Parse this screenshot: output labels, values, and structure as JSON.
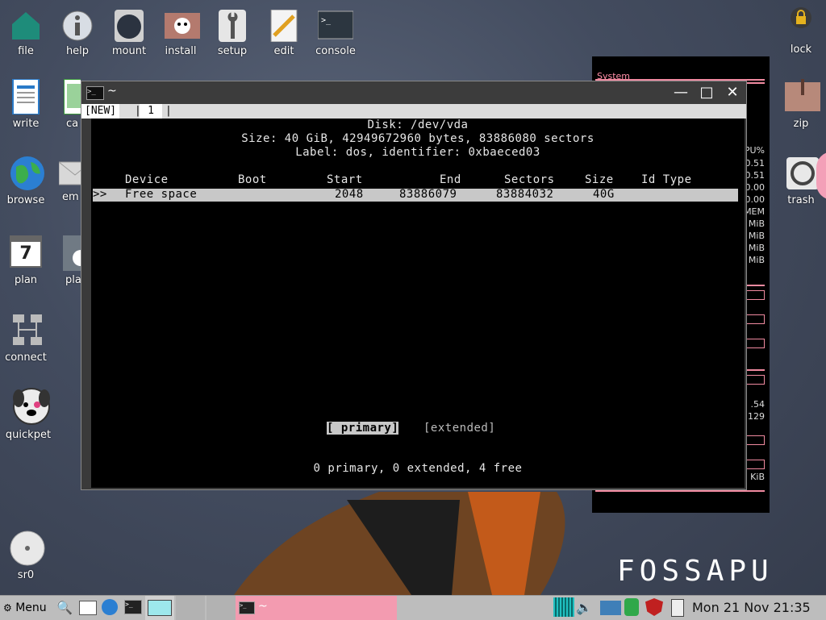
{
  "desktop": {
    "icons": [
      {
        "id": "file",
        "label": "file"
      },
      {
        "id": "help",
        "label": "help"
      },
      {
        "id": "mount",
        "label": "mount"
      },
      {
        "id": "install",
        "label": "install"
      },
      {
        "id": "setup",
        "label": "setup"
      },
      {
        "id": "edit",
        "label": "edit"
      },
      {
        "id": "console",
        "label": "console"
      },
      {
        "id": "lock",
        "label": "lock"
      },
      {
        "id": "write",
        "label": "write"
      },
      {
        "id": "calc",
        "label": "ca"
      },
      {
        "id": "zip",
        "label": "zip"
      },
      {
        "id": "browse",
        "label": "browse"
      },
      {
        "id": "email",
        "label": "em"
      },
      {
        "id": "trash",
        "label": "trash"
      },
      {
        "id": "plan",
        "label": "plan"
      },
      {
        "id": "play",
        "label": "pla"
      },
      {
        "id": "connect",
        "label": "connect"
      },
      {
        "id": "quickpet",
        "label": "quickpet"
      },
      {
        "id": "sr0",
        "label": "sr0"
      }
    ],
    "plan_day": "7",
    "brand_text": "FOSSAPU"
  },
  "sysmon": {
    "title": "System",
    "values": [
      "PU%",
      "0.51",
      "0.51",
      "0.00",
      "0.00",
      "MEM",
      "MiB",
      "MiB",
      "MiB",
      "MiB",
      ".54",
      "129",
      "KiB"
    ]
  },
  "terminal": {
    "title": "~",
    "tab_new": "[NEW]",
    "tab_1": "1",
    "disk_line": "Disk: /dev/vda",
    "size_line": "Size: 40 GiB, 42949672960 bytes, 83886080 sectors",
    "label_line": "Label: dos, identifier: 0xbaeced03",
    "headers": [
      "Device",
      "Boot",
      "Start",
      "End",
      "Sectors",
      "Size",
      "Id Type"
    ],
    "row": {
      "marker": ">>",
      "device": "Free space",
      "start": "2048",
      "end": "83886079",
      "sectors": "83884032",
      "size": "40G"
    },
    "menu_primary": "[ primary]",
    "menu_extended": "[extended]",
    "status": "0 primary, 0 extended, 4 free"
  },
  "taskbar": {
    "menu_label": "Menu",
    "task_title": "~",
    "clock": "Mon 21 Nov 21:35"
  },
  "colors": {
    "accent_pink": "#f39bb0",
    "terminal_bg": "#000000",
    "taskbar_bg": "#bdbdbd"
  }
}
